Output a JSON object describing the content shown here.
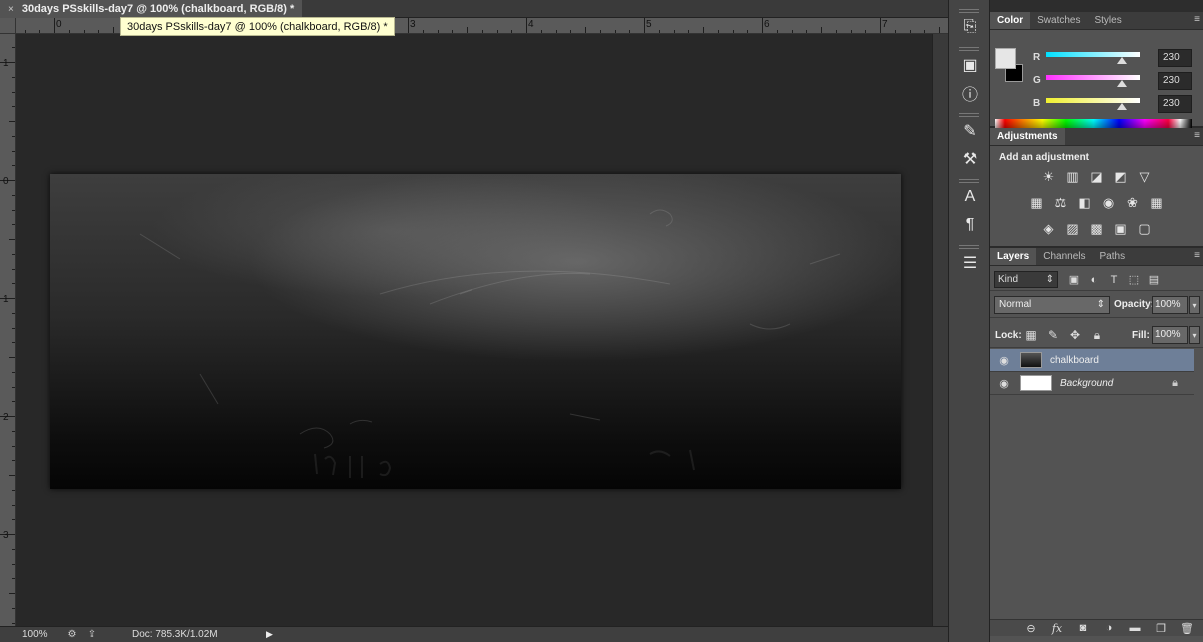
{
  "document": {
    "tab_title": "30days PSskills-day7 @ 100% (chalkboard, RGB/8) *",
    "tooltip": "30days PSskills-day7 @ 100% (chalkboard, RGB/8) *",
    "close_glyph": "×"
  },
  "rulers": {
    "horizontal": [
      "0",
      "1",
      "2",
      "3",
      "4",
      "5",
      "6",
      "7"
    ],
    "vertical": [
      "1",
      "0",
      "1",
      "2",
      "3"
    ]
  },
  "status": {
    "zoom": "100%",
    "doc_info": "Doc: 785.3K/1.02M",
    "menu_arrow": "▶"
  },
  "dock_icons": [
    "history-icon",
    "properties-icon",
    "info-icon",
    "brush-icon",
    "brush-presets-icon",
    "character-icon",
    "paragraph-icon",
    "notes-icon"
  ],
  "color_panel": {
    "tabs": [
      "Color",
      "Swatches",
      "Styles"
    ],
    "channels": [
      {
        "label": "R",
        "value": "230",
        "track": "#00d8ff"
      },
      {
        "label": "G",
        "value": "230",
        "track": "#ff40ff"
      },
      {
        "label": "B",
        "value": "230",
        "track": "#ffff40"
      }
    ],
    "foreground": "#e6e6e6",
    "background": "#000000"
  },
  "adjustments": {
    "tab": "Adjustments",
    "heading": "Add an adjustment",
    "row1": [
      "☀",
      "▥",
      "◪",
      "◩",
      "▽"
    ],
    "row2": [
      "▦",
      "⚖",
      "◧",
      "◉",
      "❀",
      "▦"
    ],
    "row3": [
      "◈",
      "▨",
      "▩",
      "▣",
      "▢"
    ]
  },
  "layers": {
    "tabs": [
      "Layers",
      "Channels",
      "Paths"
    ],
    "filter_kind": "Kind",
    "blend_mode": "Normal",
    "opacity_label": "Opacity:",
    "opacity_value": "100%",
    "lock_label": "Lock:",
    "fill_label": "Fill:",
    "fill_value": "100%",
    "items": [
      {
        "name": "chalkboard",
        "selected": true
      },
      {
        "name": "Background",
        "selected": false
      }
    ]
  }
}
